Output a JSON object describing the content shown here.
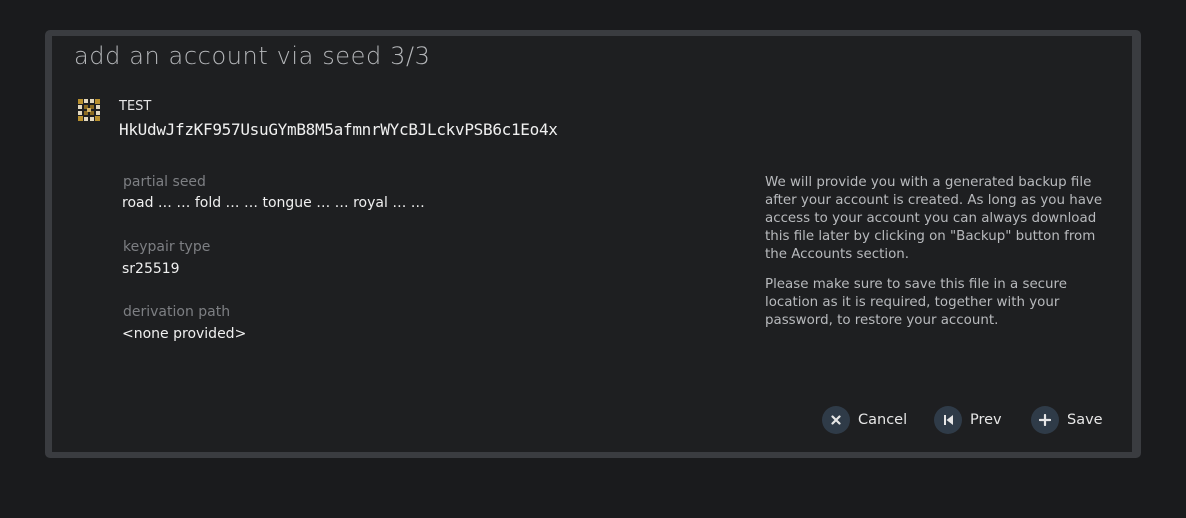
{
  "modal": {
    "title": "add an account via seed 3/3"
  },
  "account": {
    "name": "TEST",
    "address": "HkUdwJfzKF957UsuGYmB8M5afmnrWYcBJLckvPSB6c1Eo4x",
    "avatar_icon": "identicon"
  },
  "fields": {
    "partial_seed_label": "partial seed",
    "partial_seed_value": "road … … fold … … tongue … … royal … …",
    "keypair_type_label": "keypair type",
    "keypair_type_value": "sr25519",
    "derivation_path_label": "derivation path",
    "derivation_path_value": "<none provided>"
  },
  "help": {
    "paragraph1": "We will provide you with a generated backup file after your account is created. As long as you have access to your account you can always download this file later by clicking on \"Backup\" button from the Accounts section.",
    "paragraph2": "Please make sure to save this file in a secure location as it is required, together with your password, to restore your account."
  },
  "buttons": {
    "cancel": {
      "label": "Cancel",
      "icon": "close-icon"
    },
    "prev": {
      "label": "Prev",
      "icon": "step-backward-icon"
    },
    "save": {
      "label": "Save",
      "icon": "plus-icon"
    }
  },
  "colors": {
    "backdrop": "#1a1b1d",
    "modal_background": "#1e1f21",
    "modal_frame": "#3a3c40",
    "button_icon_background": "#2f3b48",
    "background_accent": "#2a8a80"
  }
}
